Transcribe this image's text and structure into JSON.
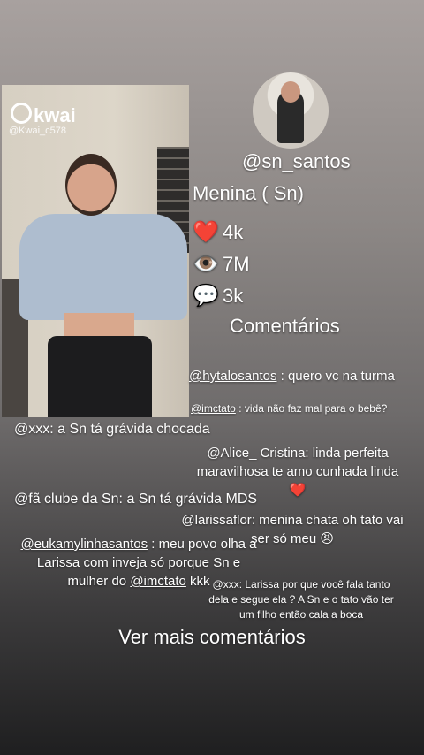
{
  "video": {
    "watermark_brand": "kwai",
    "watermark_handle": "@Kwai_c578"
  },
  "profile": {
    "username": "@sn_santos",
    "title": "Menina ( Sn)"
  },
  "stats": {
    "likes": "4k",
    "views": "7M",
    "comments": "3k"
  },
  "comments_header": "Comentários",
  "comments": [
    {
      "user": "@hytalosantos",
      "text": " : quero vc na turma"
    },
    {
      "user": "@imctato",
      "text": " : vida não faz mal para o bebê?"
    },
    {
      "user": "@xxx",
      "text": ": a Sn tá grávida chocada"
    },
    {
      "user": "@Alice_",
      "text": " Cristina: linda perfeita maravilhosa te amo cunhada linda",
      "emoji": "❤️"
    },
    {
      "user": "@fã clube da Sn",
      "text": ": a Sn tá grávida MDS"
    },
    {
      "user": "@larissaflor",
      "text": ": menina chata oh tato vai ser só meu",
      "emoji": "😠"
    },
    {
      "user": "@eukamylinhasantos",
      "text": " : meu povo olha a Larissa com inveja só porque Sn e mulher do ",
      "mention": "@imctato",
      "tail": " kkk"
    },
    {
      "user": "@xxx",
      "text": ": Larissa por que você fala tanto dela e segue ela ? A Sn e o tato vão ter um filho então cala a boca"
    }
  ],
  "see_more": "Ver mais comentários",
  "icons": {
    "likes": "heart-icon",
    "views": "eye-icon",
    "comments": "speech-bubble-icon"
  }
}
